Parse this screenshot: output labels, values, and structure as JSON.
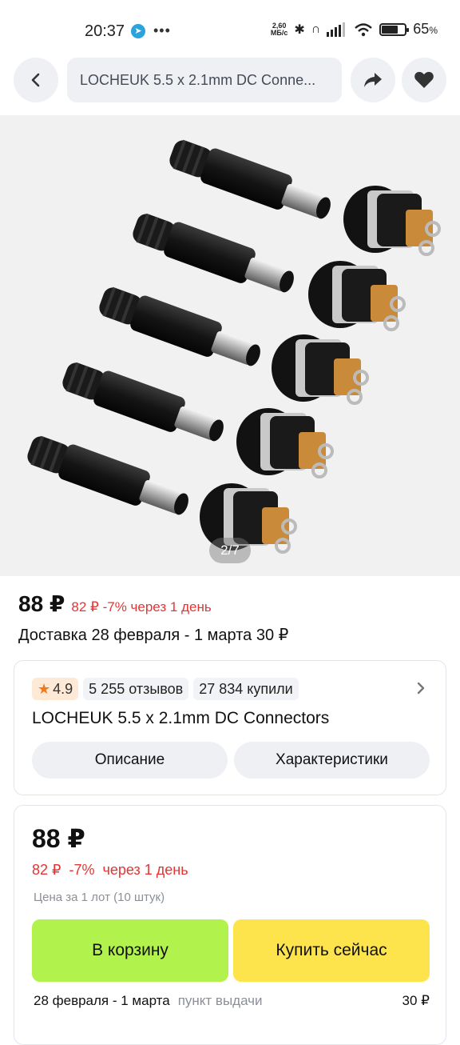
{
  "status_bar": {
    "time": "20:37",
    "net_speed_top": "2,60",
    "net_speed_bottom": "МБ/с",
    "battery_percent": "65",
    "battery_symbol": "%"
  },
  "topbar": {
    "search_text": "LOCHEUK 5.5 x 2.1mm DC Conne..."
  },
  "gallery": {
    "counter": "2/7"
  },
  "price": {
    "main": "88 ₽",
    "discount_line": "82 ₽ -7% через 1 день",
    "delivery": "Доставка 28 февраля - 1 марта 30 ₽"
  },
  "info_card": {
    "rating": "4.9",
    "reviews": "5 255 отзывов",
    "bought": "27 834 купили",
    "title": "LOCHEUK 5.5 x 2.1mm DC Connectors",
    "tab_description": "Описание",
    "tab_specs": "Характеристики"
  },
  "buy_card": {
    "price": "88 ₽",
    "discount_line": "82 ₽  -7%  через 1 день",
    "lot_note": "Цена за 1 лот (10 штук)",
    "cart_button": "В корзину",
    "buy_button": "Купить сейчас",
    "delivery_date": "28 февраля - 1 марта",
    "delivery_type": "пункт выдачи",
    "delivery_price": "30 ₽"
  },
  "colors": {
    "accent_red": "#e63434",
    "cart_green": "#b2f24c",
    "buy_yellow": "#fde34c",
    "star_orange": "#f07a1a"
  }
}
